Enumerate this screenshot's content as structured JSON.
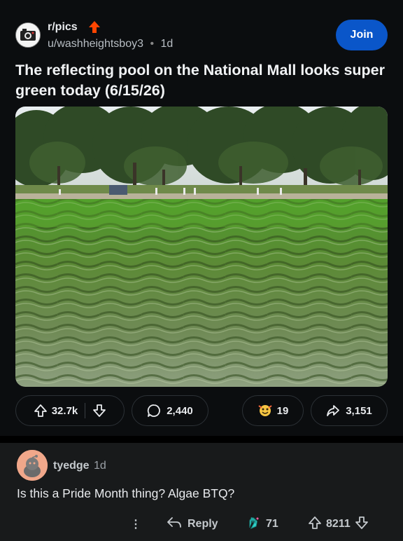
{
  "post": {
    "subreddit": "r/pics",
    "author": "u/washheightsboy3",
    "separator": "•",
    "age": "1d",
    "join_label": "Join",
    "title": "The reflecting pool on the National Mall looks super green today (6/15/26)",
    "upvotes": "32.7k",
    "comments": "2,440",
    "awards": "19",
    "shares": "3,151"
  },
  "comment": {
    "username": "tyedge",
    "age": "1d",
    "text": "Is this a Pride Month thing? Algae BTQ?",
    "more_label": "⋮",
    "reply_label": "Reply",
    "awards": "71",
    "score": "8211"
  },
  "colors": {
    "background": "#0b0d0f",
    "join_button": "#0a56c9",
    "subreddit_badge": "#ff4500",
    "comment_background": "#181a1b",
    "water": "#6f8a4a",
    "algae_green": "#5fae2e"
  },
  "icons": [
    "upvote-icon",
    "downvote-icon",
    "comment-icon",
    "award-icon",
    "share-icon",
    "reply-icon",
    "more-icon"
  ]
}
